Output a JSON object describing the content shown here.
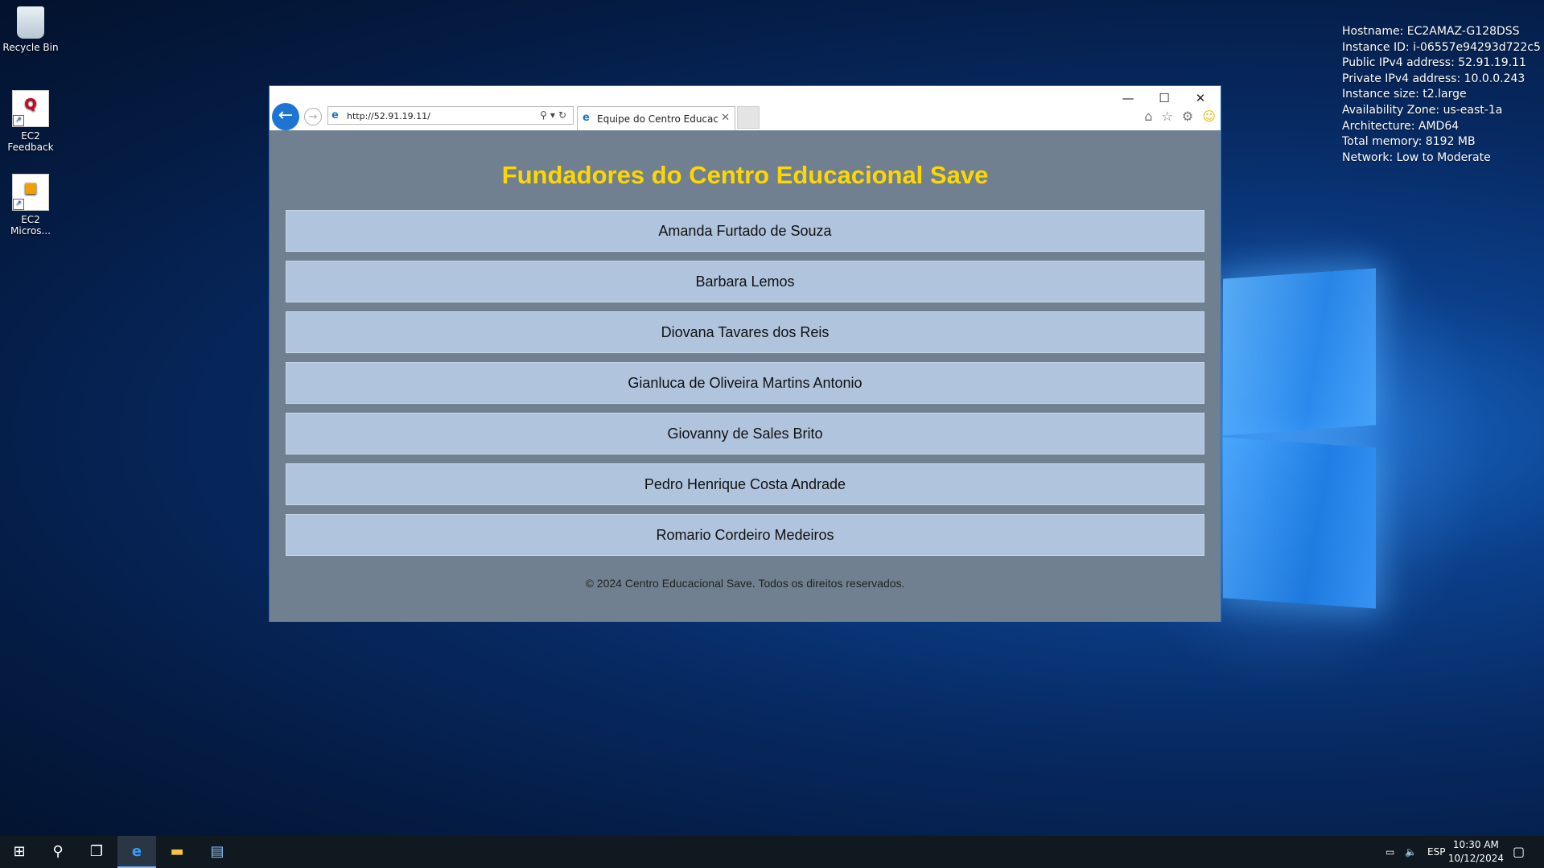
{
  "desktop": {
    "icons": [
      {
        "label": "Recycle Bin",
        "icon": "recycle-bin-icon"
      },
      {
        "label": "EC2\nFeedback",
        "line1": "EC2",
        "line2": "Feedback",
        "icon": "feedback-icon"
      },
      {
        "label": "EC2 Micros...",
        "line1": "EC2",
        "line2": "Micros...",
        "icon": "package-icon"
      }
    ],
    "sysinfo": [
      "Hostname: EC2AMAZ-G128DSS",
      "Instance ID: i-06557e94293d722c5",
      "Public IPv4 address: 52.91.19.11",
      "Private IPv4 address: 10.0.0.243",
      "Instance size: t2.large",
      "Availability Zone: us-east-1a",
      "Architecture: AMD64",
      "Total memory: 8192 MB",
      "Network: Low to Moderate"
    ]
  },
  "browser": {
    "url": "http://52.91.19.11/",
    "tab_title": "Equipe do Centro Educacio...",
    "window_controls": {
      "minimize": "—",
      "maximize": "☐",
      "close": "✕"
    }
  },
  "page": {
    "title": "Fundadores do Centro Educacional Save",
    "founders": [
      "Amanda Furtado de Souza",
      "Barbara Lemos",
      "Diovana Tavares dos Reis",
      "Gianluca de Oliveira Martins Antonio",
      "Giovanny de Sales Brito",
      "Pedro Henrique Costa Andrade",
      "Romario Cordeiro Medeiros"
    ],
    "footer": "© 2024 Centro Educacional Save. Todos os direitos reservados.",
    "colors": {
      "background": "#708090",
      "title": "#ffd700",
      "item": "#b0c4de"
    }
  },
  "taskbar": {
    "language": "ESP",
    "time": "10:30 AM",
    "date": "10/12/2024"
  }
}
